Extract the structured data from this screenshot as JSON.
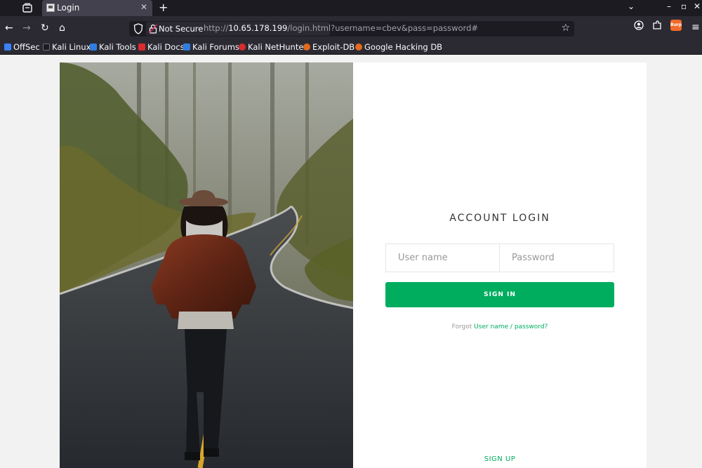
{
  "browser": {
    "tab": {
      "title": "Login",
      "close": "✕"
    },
    "new_tab": "+",
    "window_controls": {
      "list": "⌄",
      "minimize": "–",
      "maximize": "▫",
      "close": "✕"
    },
    "nav": {
      "back": "←",
      "forward": "→",
      "reload": "↻",
      "home": "⌂"
    },
    "urlbar": {
      "security_label": "Not Secure",
      "url_prefix": "http://",
      "host": "10.65.178.199",
      "path": "/login.html?username=cbev&pass=password#",
      "bookmark_star": "☆"
    },
    "toolbar_right": {
      "account": "◉",
      "extensions": "⧉",
      "burp": "Burp",
      "menu": "≡"
    },
    "bookmarks": [
      {
        "label": "OffSec",
        "color": "#3b82f6"
      },
      {
        "label": "Kali Linux",
        "color": "#1c1b22"
      },
      {
        "label": "Kali Tools",
        "color": "#2f7de1"
      },
      {
        "label": "Kali Docs",
        "color": "#d92c2c"
      },
      {
        "label": "Kali Forums",
        "color": "#2f7de1"
      },
      {
        "label": "Kali NetHunter",
        "color": "#d92c2c"
      },
      {
        "label": "Exploit-DB",
        "color": "#e2691d"
      },
      {
        "label": "Google Hacking DB",
        "color": "#e2691d"
      }
    ]
  },
  "login": {
    "title": "ACCOUNT LOGIN",
    "username_placeholder": "User name",
    "password_placeholder": "Password",
    "signin_label": "SIGN IN",
    "forgot_prefix": "Forgot",
    "forgot_link": "User name / password?",
    "signup_label": "SIGN UP"
  },
  "colors": {
    "accent": "#00ad5f",
    "chrome_dark": "#1c1b22",
    "chrome": "#2b2a33",
    "page_bg": "#f2f2f2"
  }
}
